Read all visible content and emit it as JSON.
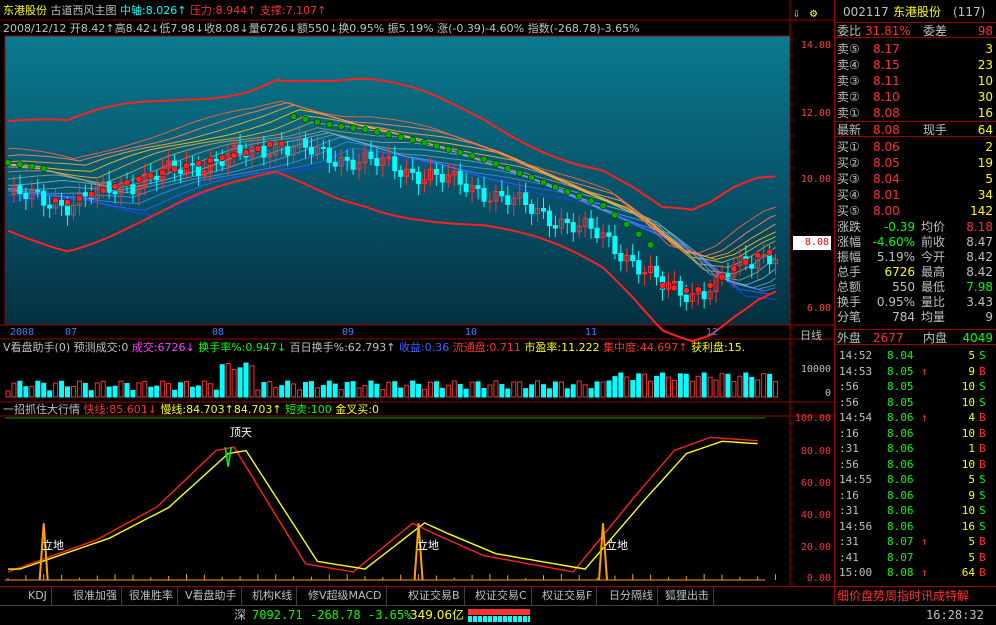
{
  "header": {
    "stock_name": "东港股份",
    "indicator_name": "古道西风主图",
    "axis_label": "中轴",
    "axis_value": "8.026",
    "pressure_label": "压力",
    "pressure_value": "8.944",
    "support_label": "支撑",
    "support_value": "7.107",
    "date": "2008/12/12",
    "open_label": "开",
    "open": "8.42",
    "high_label": "高",
    "high": "8.42",
    "low_label": "低",
    "low": "7.98",
    "close_label": "收",
    "close": "8.08",
    "volume_label": "量",
    "volume": "6726",
    "amount_label": "额",
    "amount": "550",
    "turnover_label": "换",
    "turnover": "0.95%",
    "amplitude_label": "振",
    "amplitude": "5.19%",
    "change_label": "涨",
    "change": "(-0.39)-4.60%",
    "index_label": "指数",
    "index": "(-268.78)-3.65%"
  },
  "main_yaxis": [
    "14.00",
    "12.00",
    "10.00",
    "8.08",
    "6.00"
  ],
  "current_price_tag": "8.08",
  "x_axis": [
    "2008",
    "07",
    "08",
    "09",
    "10",
    "11",
    "12"
  ],
  "x_axis_right": "日线",
  "sub1": {
    "title": "V看盘助手(0)",
    "predict_label": "预测成交:0",
    "volume_label": "成交:6726",
    "turnover_label": "换手率%:0.947",
    "hundred_day_label": "百日换手%:62.793",
    "income_label": "收益:0.36",
    "float_label": "流通盘:0.711",
    "pe_label": "市盈率:11.222",
    "conc_label": "集中度:44.697",
    "profit_label": "获利盘:15.",
    "yaxis": [
      "10000",
      "0"
    ]
  },
  "sub2": {
    "title": "一招抓住大行情",
    "fast_label": "快线:85.601",
    "slow_label": "慢线:84.703",
    "slow_value2": "84.703",
    "short_label": "短卖:100",
    "cross_label": "金叉买:0",
    "top_label": "顶天",
    "bottom_label": "立地",
    "yaxis": [
      "100.00",
      "80.00",
      "60.00",
      "40.00",
      "20.00",
      "0.00"
    ]
  },
  "right_panel": {
    "code": "002117",
    "name": "东港股份",
    "count": "(117)",
    "ratio_label": "委比",
    "ratio_value": "31.81%",
    "diff_label": "委差",
    "diff_value": "98",
    "sells": [
      {
        "label": "卖⑤",
        "price": "8.17",
        "vol": "3"
      },
      {
        "label": "卖④",
        "price": "8.15",
        "vol": "23"
      },
      {
        "label": "卖③",
        "price": "8.11",
        "vol": "10"
      },
      {
        "label": "卖②",
        "price": "8.10",
        "vol": "30"
      },
      {
        "label": "卖①",
        "price": "8.08",
        "vol": "16"
      }
    ],
    "latest_label": "最新",
    "latest": "8.08",
    "now_label": "现手",
    "now": "64",
    "buys": [
      {
        "label": "买①",
        "price": "8.06",
        "vol": "2"
      },
      {
        "label": "买②",
        "price": "8.05",
        "vol": "19"
      },
      {
        "label": "买③",
        "price": "8.04",
        "vol": "5"
      },
      {
        "label": "买④",
        "price": "8.01",
        "vol": "34"
      },
      {
        "label": "买⑤",
        "price": "8.00",
        "vol": "142"
      }
    ],
    "stats": [
      {
        "l1": "涨跌",
        "v1": "-0.39",
        "l2": "均价",
        "v2": "8.18"
      },
      {
        "l1": "涨幅",
        "v1": "-4.60%",
        "l2": "前收",
        "v2": "8.47"
      },
      {
        "l1": "振幅",
        "v1": "5.19%",
        "l2": "今开",
        "v2": "8.42"
      },
      {
        "l1": "总手",
        "v1": "6726",
        "l2": "最高",
        "v2": "8.42"
      },
      {
        "l1": "总额",
        "v1": "550",
        "l2": "最低",
        "v2": "7.98"
      },
      {
        "l1": "换手",
        "v1": "0.95%",
        "l2": "量比",
        "v2": "3.43"
      },
      {
        "l1": "分笔",
        "v1": "784",
        "l2": "均量",
        "v2": "9"
      }
    ],
    "outer_label": "外盘",
    "outer": "2677",
    "inner_label": "内盘",
    "inner": "4049",
    "trades": [
      {
        "t": "14:52",
        "p": "8.04",
        "arrow": "",
        "v": "5",
        "s": "S"
      },
      {
        "t": "14:53",
        "p": "8.05",
        "arrow": "↑",
        "v": "9",
        "s": "B"
      },
      {
        "t": ":56",
        "p": "8.05",
        "arrow": "",
        "v": "10",
        "s": "S"
      },
      {
        "t": ":56",
        "p": "8.05",
        "arrow": "",
        "v": "10",
        "s": "S"
      },
      {
        "t": "14:54",
        "p": "8.06",
        "arrow": "↑",
        "v": "4",
        "s": "B"
      },
      {
        "t": ":16",
        "p": "8.06",
        "arrow": "",
        "v": "10",
        "s": "B"
      },
      {
        "t": ":31",
        "p": "8.06",
        "arrow": "",
        "v": "1",
        "s": "B"
      },
      {
        "t": ":56",
        "p": "8.06",
        "arrow": "",
        "v": "10",
        "s": "B"
      },
      {
        "t": "14:55",
        "p": "8.06",
        "arrow": "",
        "v": "5",
        "s": "S"
      },
      {
        "t": ":16",
        "p": "8.06",
        "arrow": "",
        "v": "9",
        "s": "S"
      },
      {
        "t": ":31",
        "p": "8.06",
        "arrow": "",
        "v": "10",
        "s": "S"
      },
      {
        "t": "14:56",
        "p": "8.06",
        "arrow": "",
        "v": "16",
        "s": "S"
      },
      {
        "t": ":31",
        "p": "8.07",
        "arrow": "↑",
        "v": "5",
        "s": "B"
      },
      {
        "t": ":41",
        "p": "8.07",
        "arrow": "",
        "v": "5",
        "s": "B"
      },
      {
        "t": "15:00",
        "p": "8.08",
        "arrow": "↑",
        "v": "64",
        "s": "B"
      }
    ],
    "bottom_tabs": [
      "细价盘势周指时讯成特解"
    ]
  },
  "tabs": [
    "KDJ",
    "很准加强",
    "很准胜率",
    "V看盘助手",
    "机构K线",
    "修V超级MACD",
    "权证交易B",
    "权证交易C",
    "权证交易F",
    "日分隔线",
    "狐狸出击"
  ],
  "status": {
    "market": "深",
    "index": "7092.71",
    "change": "-268.78",
    "pct": "-3.65%",
    "amount": "349.06亿",
    "time": "16:28:32"
  },
  "colors": {
    "up": "#ff3030",
    "down": "#00ffff",
    "bg_main": "#005a70",
    "yellow": "#ffff00",
    "green": "#00ff00",
    "magenta": "#ff40ff"
  }
}
